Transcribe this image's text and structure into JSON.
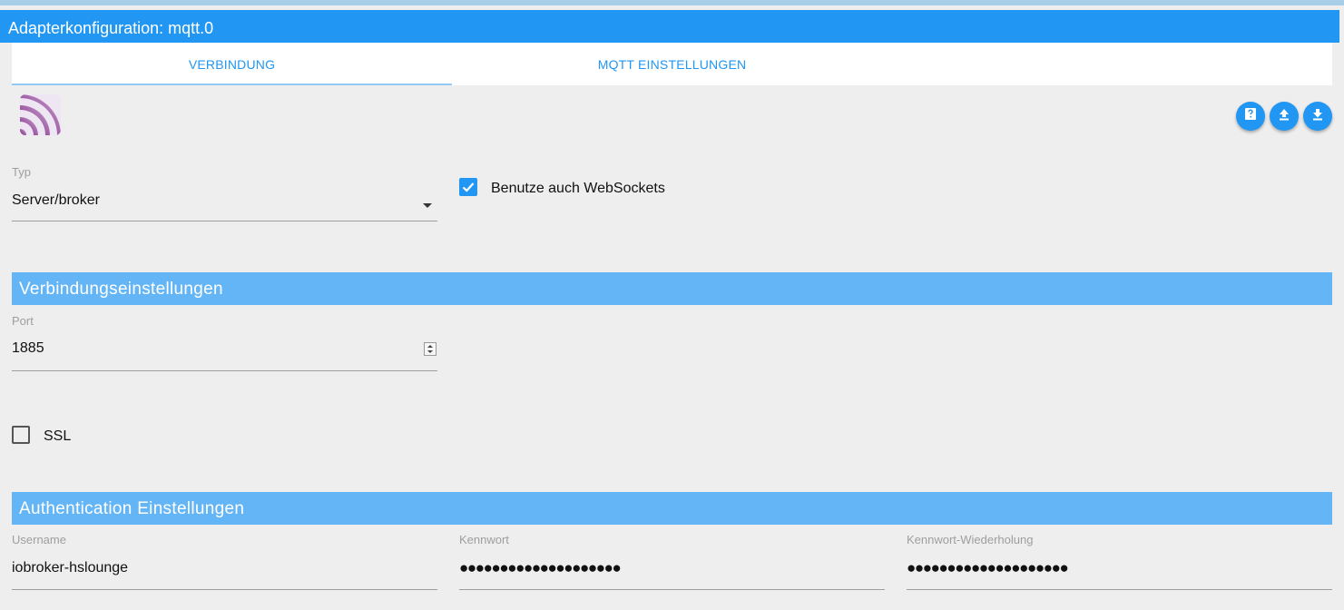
{
  "window": {
    "title": "Adapterkonfiguration: mqtt.0"
  },
  "tabs": [
    {
      "label": "VERBINDUNG",
      "active": true
    },
    {
      "label": "MQTT EINSTELLUNGEN",
      "active": false
    }
  ],
  "logo": {
    "icon": "mqtt-logo-icon"
  },
  "actions": [
    {
      "icon": "help-icon"
    },
    {
      "icon": "upload-icon"
    },
    {
      "icon": "download-icon"
    }
  ],
  "type_field": {
    "label": "Typ",
    "value": "Server/broker"
  },
  "websockets": {
    "label": "Benutze auch WebSockets",
    "checked": true
  },
  "connection_section": {
    "title": "Verbindungseinstellungen"
  },
  "port_field": {
    "label": "Port",
    "value": "1885"
  },
  "ssl": {
    "label": "SSL",
    "checked": false
  },
  "auth_section": {
    "title": "Authentication Einstellungen"
  },
  "username_field": {
    "label": "Username",
    "value": "iobroker-hslounge"
  },
  "password_field": {
    "label": "Kennwort",
    "value": "●●●●●●●●●●●●●●●●●●●●"
  },
  "password_repeat_field": {
    "label": "Kennwort-Wiederholung",
    "value": "●●●●●●●●●●●●●●●●●●●●"
  },
  "colors": {
    "primary": "#2196f3",
    "section": "#64b5f6",
    "background": "#eeeeee"
  }
}
